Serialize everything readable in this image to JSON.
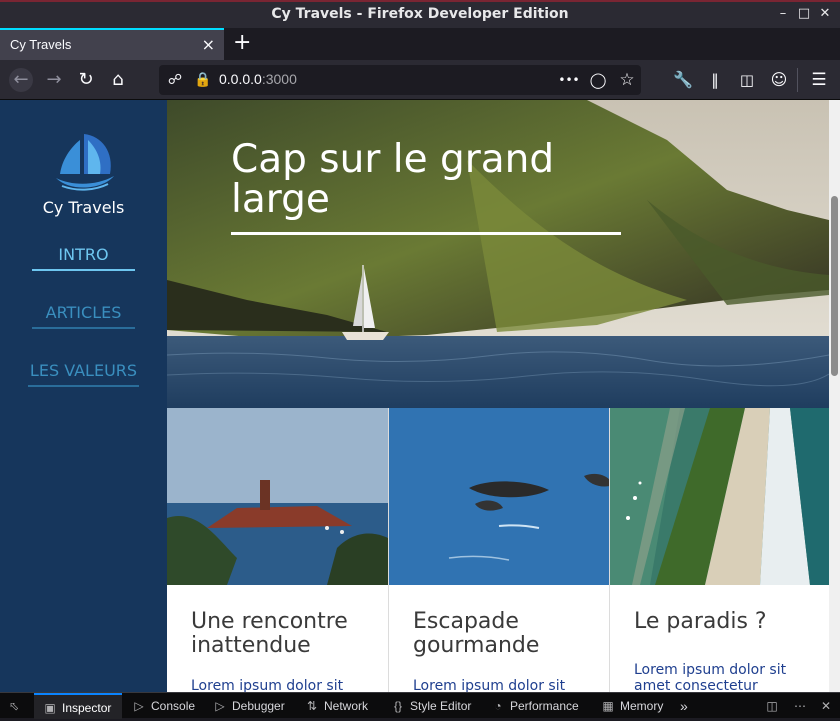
{
  "window": {
    "title": "Cy Travels - Firefox Developer Edition"
  },
  "tab": {
    "title": "Cy Travels",
    "close_glyph": "×",
    "new_tab_glyph": "+"
  },
  "urlbar": {
    "host": "0.0.0.0",
    "port": ":3000",
    "more_glyph": "•••"
  },
  "sidebar": {
    "brand": "Cy Travels",
    "nav": [
      {
        "label": "INTRO",
        "active": true
      },
      {
        "label": "ARTICLES",
        "active": false
      },
      {
        "label": "LES VALEURS",
        "active": false
      }
    ]
  },
  "hero": {
    "title": "Cap sur le grand large"
  },
  "cards": [
    {
      "title": "Une rencontre inattendue",
      "text": "Lorem ipsum dolor sit"
    },
    {
      "title": "Escapade gourmande",
      "text": "Lorem ipsum dolor sit"
    },
    {
      "title": "Le paradis ?",
      "text": "Lorem ipsum dolor sit amet consectetur adipisicing elit"
    }
  ],
  "devtools": {
    "tabs": [
      "Inspector",
      "Console",
      "Debugger",
      "Network",
      "Style Editor",
      "Performance",
      "Memory"
    ],
    "active": "Inspector"
  },
  "colors": {
    "sidebar_bg": "#16365c",
    "nav_active": "#6ec6f0",
    "nav_inactive": "#3a8fbf",
    "card_link": "#1f3f8f"
  }
}
